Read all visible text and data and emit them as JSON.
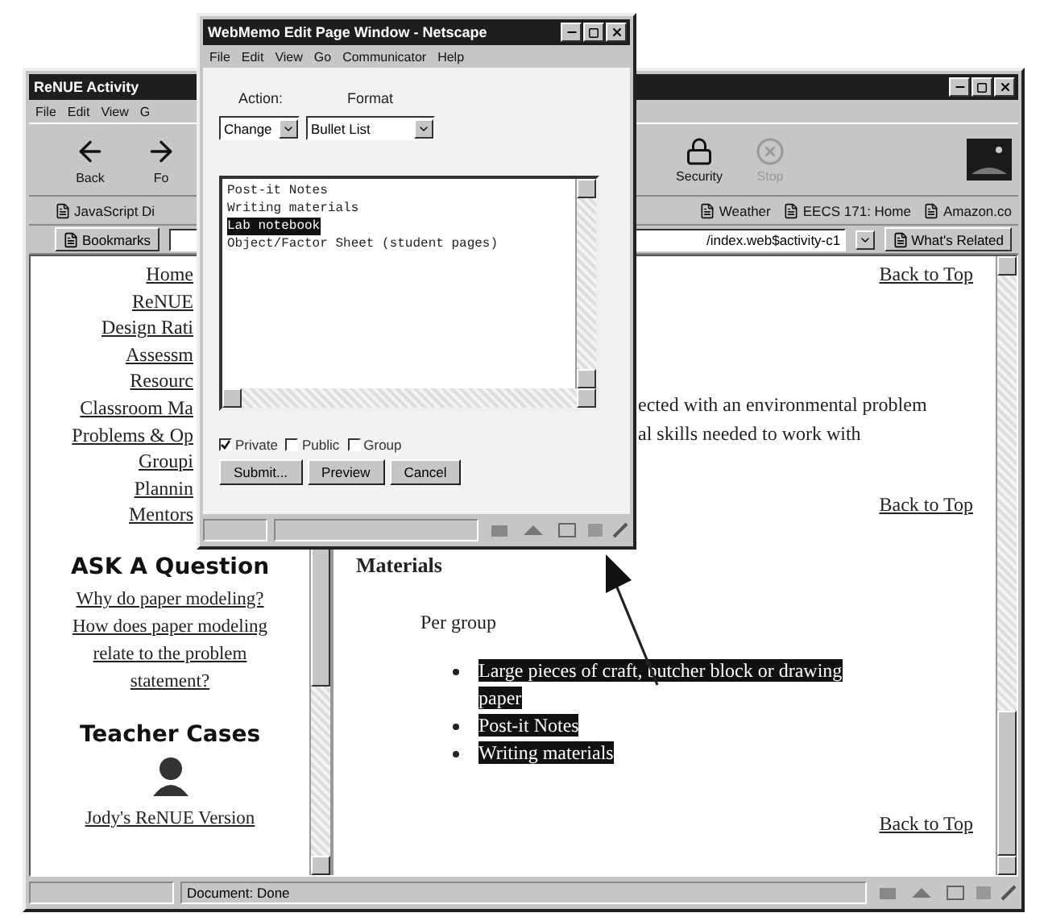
{
  "main_window": {
    "title": "ReNUE Activity",
    "menu": [
      "File",
      "Edit",
      "View",
      "G"
    ],
    "toolbar": [
      {
        "label": "Back",
        "kind": "back",
        "disabled": false
      },
      {
        "label": "Fo",
        "kind": "forward",
        "disabled": false
      },
      {
        "label": "Security",
        "kind": "security",
        "disabled": false
      },
      {
        "label": "Stop",
        "kind": "stop",
        "disabled": true
      }
    ],
    "personal_toolbar": {
      "left": [
        "JavaScript Di"
      ],
      "right": [
        "Weather",
        "EECS 171: Home",
        "Amazon.co"
      ]
    },
    "bookmarks_button": "Bookmarks",
    "location": "/index.web$activity-c1",
    "whats_related": "What's Related",
    "left_frame": {
      "nav_links": [
        "Home",
        "ReNUE",
        "Design Rati",
        "Assessm",
        "Resourc",
        "Classroom Ma",
        "Problems & Op",
        "Groupi",
        "Plannin",
        "Mentors"
      ],
      "ask_heading": "ASK A Question",
      "ask_links": [
        "Why do paper modeling?",
        "How does paper modeling relate to the problem statement?"
      ],
      "cases_heading": "Teacher Cases",
      "case_link": "Jody's ReNUE Version"
    },
    "right_frame": [
      {
        "kind": "link",
        "text": "Back to Top"
      },
      {
        "kind": "paragraph",
        "lines": [
          "ected with an environmental problem",
          "al skills needed to work with"
        ]
      },
      {
        "kind": "link",
        "text": "Back to Top"
      },
      {
        "kind": "heading",
        "text": "Materials"
      },
      {
        "kind": "text",
        "text": "Per group"
      },
      {
        "kind": "bullets",
        "items": [
          {
            "text": "Large pieces of craft, butcher block or drawing paper",
            "selected": true
          },
          {
            "text": "Post-it Notes",
            "selected": true
          },
          {
            "text": "Writing materials",
            "selected": true
          }
        ]
      },
      {
        "kind": "link",
        "text": "Back to Top"
      }
    ],
    "status": "Document: Done"
  },
  "popup_window": {
    "title": "WebMemo Edit Page Window - Netscape",
    "menu": [
      "File",
      "Edit",
      "View",
      "Go",
      "Communicator",
      "Help"
    ],
    "action_label": "Action:",
    "format_label": "Format",
    "action_value": "Change",
    "format_value": "Bullet List",
    "memo_lines": [
      {
        "text": "Post-it Notes",
        "selected": false
      },
      {
        "text": "Writing materials",
        "selected": false
      },
      {
        "text": "Lab notebook",
        "selected": true
      },
      {
        "text": "Object/Factor Sheet (student pages)",
        "selected": false
      }
    ],
    "options": [
      {
        "label": "Private",
        "checked": true
      },
      {
        "label": "Public",
        "checked": false
      },
      {
        "label": "Group",
        "checked": false
      }
    ],
    "buttons": [
      "Submit...",
      "Preview",
      "Cancel"
    ]
  }
}
